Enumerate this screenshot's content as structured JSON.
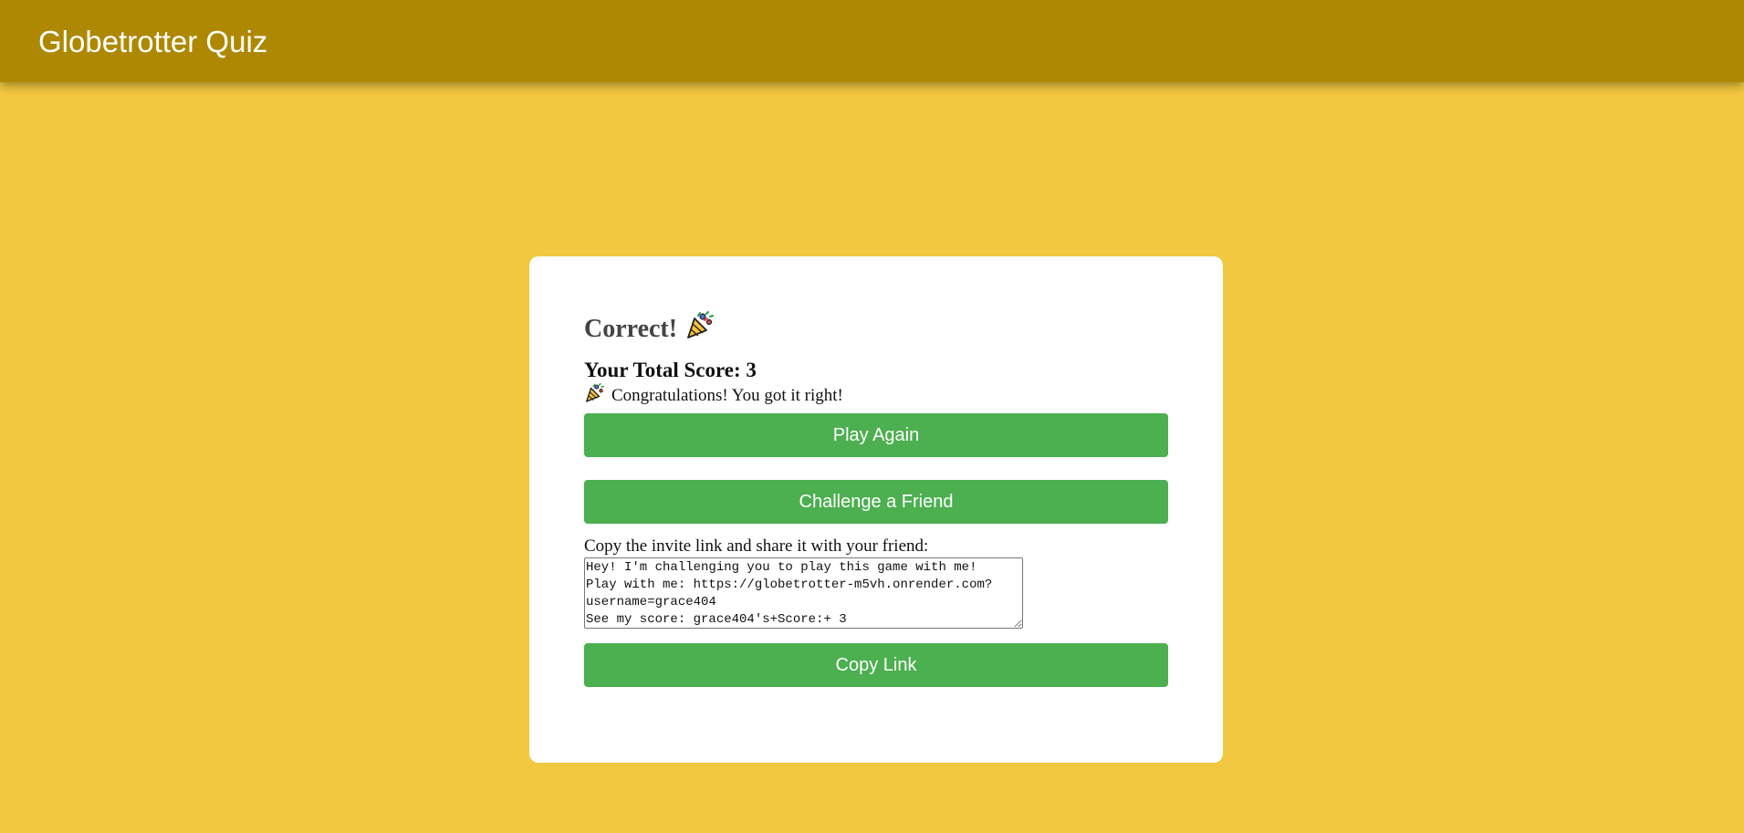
{
  "header": {
    "title": "Globetrotter Quiz"
  },
  "result": {
    "heading": "Correct!",
    "heading_emoji": "party-popper",
    "score_label": "Your Total Score: 3",
    "congrats_message": "Congratulations! You got it right!",
    "congrats_emoji": "party-popper"
  },
  "actions": {
    "play_again_label": "Play Again",
    "challenge_label": "Challenge a Friend",
    "copy_link_label": "Copy Link"
  },
  "invite": {
    "label": "Copy the invite link and share it with your friend:",
    "message": "Hey! I'm challenging you to play this game with me!\nPlay with me: https://globetrotter-m5vh.onrender.com?username=grace404\nSee my score: grace404's+Score:+ 3"
  },
  "colors": {
    "header_bg": "#ad8800",
    "page_bg": "#f2c840",
    "button_bg": "#4caf50",
    "card_bg": "#ffffff"
  }
}
